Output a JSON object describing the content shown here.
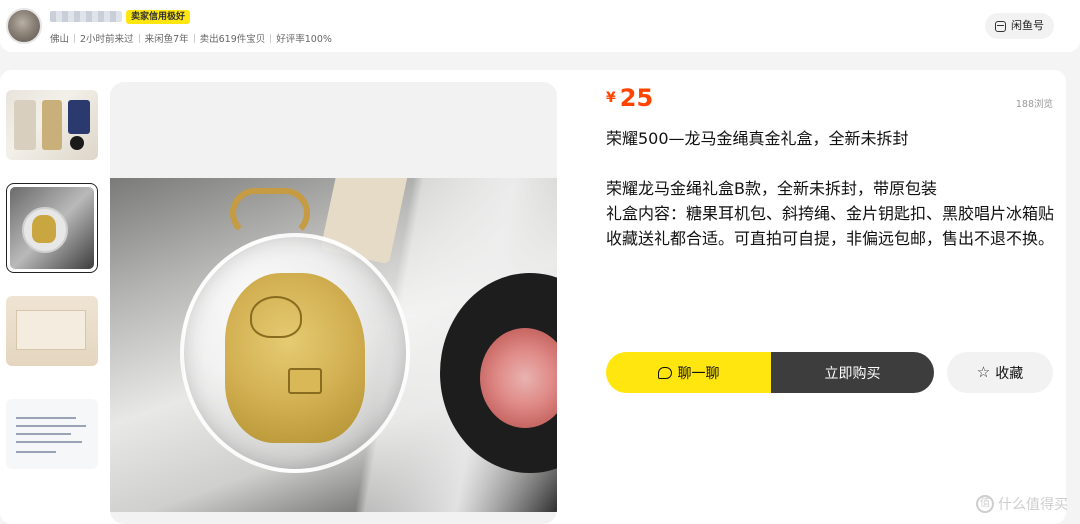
{
  "seller": {
    "credit_badge": "卖家信用极好",
    "location": "佛山",
    "last_active": "2小时前来过",
    "joined": "来闲鱼7年",
    "sold": "卖出619件宝贝",
    "rating": "好评率100%",
    "xianyu_id_label": "闲鱼号"
  },
  "product": {
    "currency": "¥",
    "price": "25",
    "views": "188浏览",
    "title": "荣耀500—龙马金绳真金礼盒，全新未拆封",
    "description": [
      "荣耀龙马金绳礼盒B款，全新未拆封，带原包装",
      "礼盒内容：糖果耳机包、斜挎绳、金片钥匙扣、黑胶唱片冰箱贴",
      "收藏送礼都合适。可直拍可自提，非偏远包邮，售出不退不换。"
    ]
  },
  "actions": {
    "chat_label": "聊一聊",
    "buy_label": "立即购买",
    "favorite_label": "收藏"
  },
  "watermark": {
    "text": "什么值得买",
    "icon_glyph": "值"
  },
  "icons": [
    "chat-bubble-icon",
    "star-icon",
    "id-card-icon"
  ],
  "colors": {
    "accent_yellow": "#ffe60f",
    "price_orange": "#ff4400",
    "buy_button": "#3d3d3d"
  }
}
